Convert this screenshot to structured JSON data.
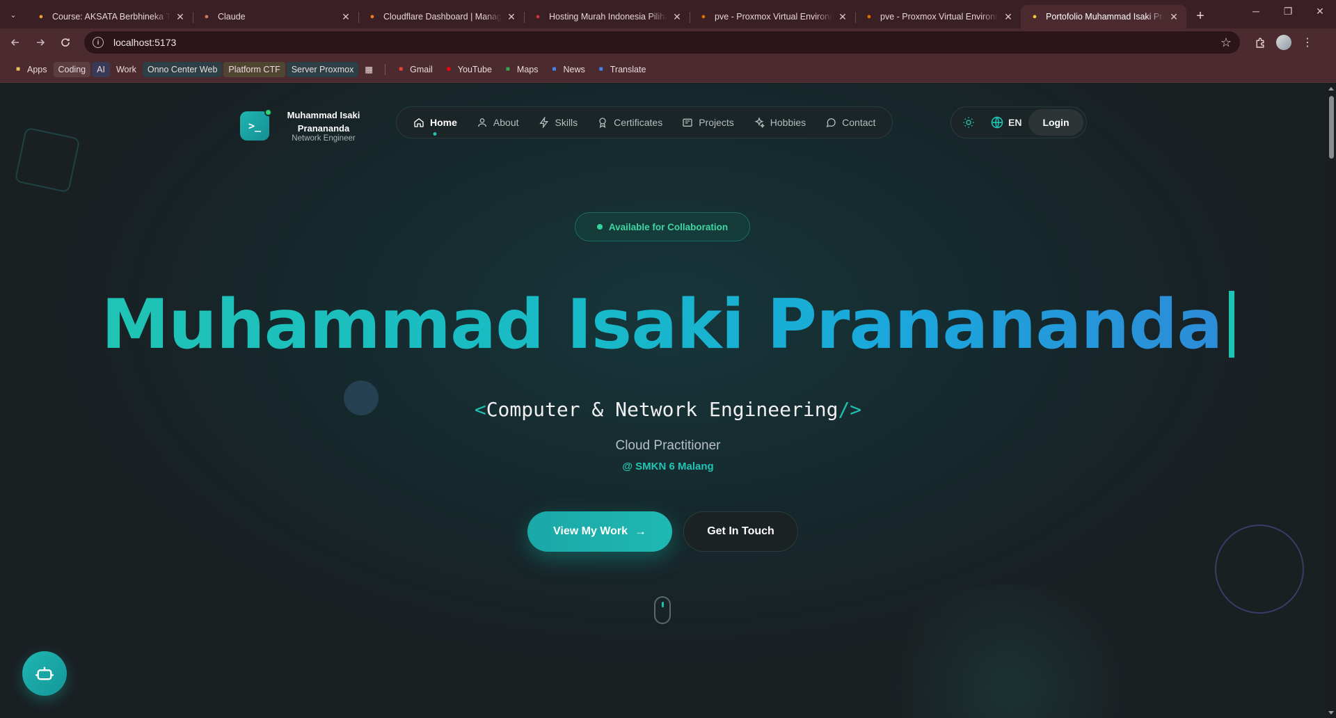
{
  "browser": {
    "tabs": [
      {
        "title": "Course: AKSATA Berbhineka Tan",
        "icon": "moodle-icon",
        "color": "#f29d38"
      },
      {
        "title": "Claude",
        "icon": "claude-icon",
        "color": "#d97757"
      },
      {
        "title": "Cloudflare Dashboard | Manage",
        "icon": "cloudflare-icon",
        "color": "#f38020"
      },
      {
        "title": "Hosting Murah Indonesia Piliha",
        "icon": "hosting-icon",
        "color": "#d0343a"
      },
      {
        "title": "pve - Proxmox Virtual Environm",
        "icon": "proxmox-icon",
        "color": "#e57000"
      },
      {
        "title": "pve - Proxmox Virtual Environm",
        "icon": "proxmox-icon",
        "color": "#e57000"
      },
      {
        "title": "Portofolio Muhammad Isaki Pra",
        "icon": "portfolio-icon",
        "color": "#f5c542",
        "active": true
      }
    ],
    "url": "localhost:5173",
    "bookmarks": [
      {
        "label": "Apps",
        "icon": "apps-grid-icon",
        "style": "plain"
      },
      {
        "label": "Coding",
        "style": "chip-grey"
      },
      {
        "label": "AI",
        "style": "chip-blue"
      },
      {
        "label": "Work",
        "style": "plain"
      },
      {
        "label": "Onno Center Web",
        "style": "chip-teal"
      },
      {
        "label": "Platform CTF",
        "style": "chip-yellow"
      },
      {
        "label": "Server Proxmox",
        "style": "chip-teal"
      },
      {
        "label": "Gmail",
        "icon": "gmail-icon",
        "style": "plain"
      },
      {
        "label": "YouTube",
        "icon": "youtube-icon",
        "style": "plain"
      },
      {
        "label": "Maps",
        "icon": "maps-icon",
        "style": "plain"
      },
      {
        "label": "News",
        "icon": "news-icon",
        "style": "plain"
      },
      {
        "label": "Translate",
        "icon": "translate-icon",
        "style": "plain"
      }
    ]
  },
  "site": {
    "brand": {
      "name": "Muhammad Isaki Pranand",
      "name_full": "Muhammad Isaki Pranananda",
      "name_line": "Muhammad Isaki Pranananda",
      "role": "Network Engineer",
      "logo_glyph": ">_"
    },
    "nav": [
      {
        "label": "Home",
        "icon": "home-icon",
        "active": true
      },
      {
        "label": "About",
        "icon": "user-icon"
      },
      {
        "label": "Skills",
        "icon": "lightning-icon"
      },
      {
        "label": "Certificates",
        "icon": "award-icon"
      },
      {
        "label": "Projects",
        "icon": "folder-icon"
      },
      {
        "label": "Hobbies",
        "icon": "sparkles-icon"
      },
      {
        "label": "Contact",
        "icon": "chat-bubble-icon"
      }
    ],
    "lang": "EN",
    "login_label": "Login",
    "hero": {
      "badge": "Available for Collaboration",
      "name": "Muhammad Isaki Pranananda",
      "subtitle_open": "<",
      "subtitle": "Computer & Network Engineering",
      "subtitle_close": "/>",
      "role": "Cloud Practitioner",
      "school": "@ SMKN 6 Malang",
      "primary_cta": "View My Work",
      "secondary_cta": "Get In Touch"
    },
    "accent": "#20c0b0"
  }
}
